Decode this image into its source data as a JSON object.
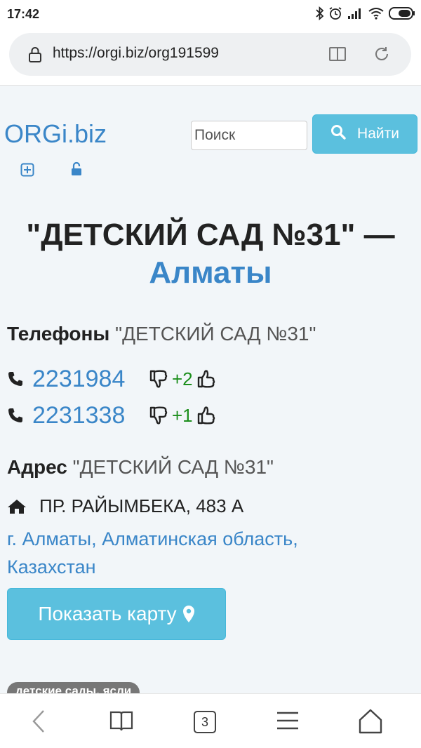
{
  "status_bar": {
    "time": "17:42",
    "icons": [
      "bluetooth-icon",
      "alarm-icon",
      "signal-icon",
      "wifi-icon",
      "battery-icon"
    ]
  },
  "browser": {
    "url": "https://orgi.biz/org191599",
    "tab_count": "3"
  },
  "header": {
    "logo": "ORGi.biz",
    "search_placeholder": "Поиск",
    "search_button": "Найти"
  },
  "page": {
    "title": "\"ДЕТСКИЙ САД №31\" —",
    "city": "Алматы",
    "phones_heading": "Телефоны",
    "org_name": "\"ДЕТСКИЙ САД №31\"",
    "phones": [
      {
        "number": "2231984",
        "score": "+2"
      },
      {
        "number": "2231338",
        "score": "+1"
      }
    ],
    "address_heading": "Адрес",
    "street": "ПР. РАЙЫМБЕКА, 483 А",
    "region": "г. Алматы, Алматинская область, Казахстан",
    "map_button": "Показать карту",
    "tag": "детские сады, ясли"
  },
  "colors": {
    "link": "#3a86c8",
    "button": "#5bc0de",
    "score": "#1d8f1d"
  }
}
